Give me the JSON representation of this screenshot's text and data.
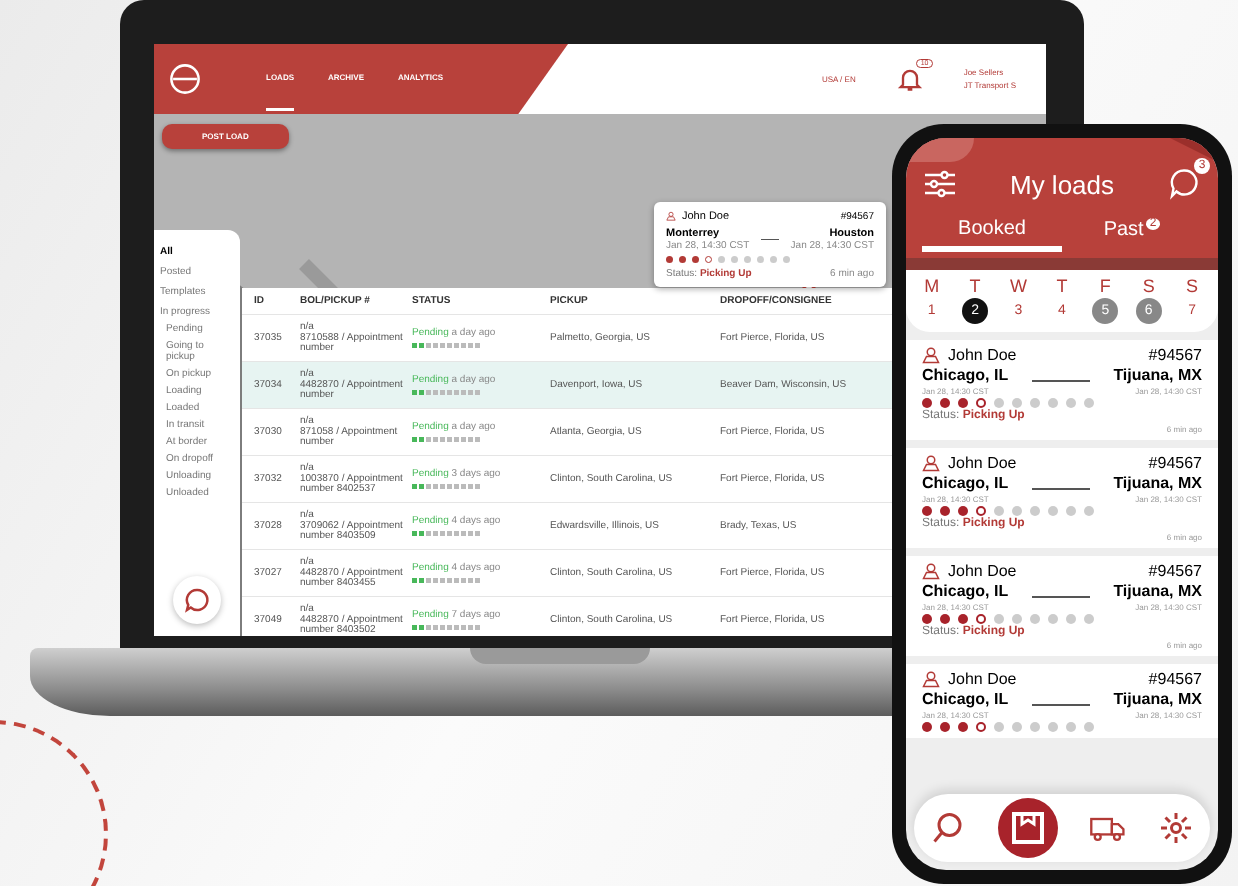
{
  "laptop": {
    "nav": [
      {
        "label": "LOADS",
        "selected": true
      },
      {
        "label": "ARCHIVE",
        "selected": false
      },
      {
        "label": "ANALYTICS",
        "selected": false
      }
    ],
    "region": "USA / EN",
    "notifications": "10",
    "user_name": "Joe Sellers",
    "user_company": "JT Transport S",
    "post_button": "POST LOAD",
    "sidebar": [
      {
        "label": "All",
        "kind": "header"
      },
      {
        "label": "Posted",
        "kind": "item"
      },
      {
        "label": "Templates",
        "kind": "item"
      },
      {
        "label": "In progress",
        "kind": "item"
      },
      {
        "label": "Pending",
        "kind": "sub"
      },
      {
        "label": "Going to pickup",
        "kind": "sub"
      },
      {
        "label": "On pickup",
        "kind": "sub"
      },
      {
        "label": "Loading",
        "kind": "sub"
      },
      {
        "label": "Loaded",
        "kind": "sub"
      },
      {
        "label": "In transit",
        "kind": "sub"
      },
      {
        "label": "At border",
        "kind": "sub"
      },
      {
        "label": "On dropoff",
        "kind": "sub"
      },
      {
        "label": "Unloading",
        "kind": "sub"
      },
      {
        "label": "Unloaded",
        "kind": "sub"
      }
    ],
    "popup": {
      "driver": "John Doe",
      "id": "#94567",
      "from": "Monterrey",
      "from_time": "Jan 28, 14:30 CST",
      "to": "Houston",
      "to_time": "Jan 28, 14:30 CST",
      "level": 0.3,
      "status_label": "Status:",
      "status": "Picking Up",
      "ago": "6 min ago"
    },
    "table": {
      "columns": [
        "ID",
        "BOL/PICKUP #",
        "STATUS",
        "PICKUP",
        "DROPOFF/CONSIGNEE"
      ],
      "rows": [
        {
          "id": "37035",
          "bol": "n/a",
          "bol_detail": "8710588 / Appointment number",
          "status": "Pending",
          "ago": "a day ago",
          "pickup": "Palmetto, Georgia, US",
          "dropoff": "Fort Pierce, Florida, US",
          "selected": false
        },
        {
          "id": "37034",
          "bol": "n/a",
          "bol_detail": "4482870 / Appointment number",
          "status": "Pending",
          "ago": "a day ago",
          "pickup": "Davenport, Iowa, US",
          "dropoff": "Beaver Dam, Wisconsin, US",
          "selected": true
        },
        {
          "id": "37030",
          "bol": "n/a",
          "bol_detail": "871058 / Appointment number",
          "status": "Pending",
          "ago": "a day ago",
          "pickup": "Atlanta, Georgia, US",
          "dropoff": "Fort Pierce, Florida, US",
          "selected": false
        },
        {
          "id": "37032",
          "bol": "n/a",
          "bol_detail": "1003870 / Appointment number 8402537",
          "status": "Pending",
          "ago": "3 days ago",
          "pickup": "Clinton, South Carolina, US",
          "dropoff": "Fort Pierce, Florida, US",
          "selected": false
        },
        {
          "id": "37028",
          "bol": "n/a",
          "bol_detail": "3709062 / Appointment number 8403509",
          "status": "Pending",
          "ago": "4 days ago",
          "pickup": "Edwardsville, Illinois, US",
          "dropoff": "Brady, Texas, US",
          "selected": false
        },
        {
          "id": "37027",
          "bol": "n/a",
          "bol_detail": "4482870 / Appointment number 8403455",
          "status": "Pending",
          "ago": "4 days ago",
          "pickup": "Clinton, South Carolina, US",
          "dropoff": "Fort Pierce, Florida, US",
          "selected": false
        },
        {
          "id": "37049",
          "bol": "n/a",
          "bol_detail": "4482870 / Appointment number 8403502",
          "status": "Pending",
          "ago": "7 days ago",
          "pickup": "Clinton, South Carolina, US",
          "dropoff": "Fort Pierce, Florida, US",
          "selected": false
        }
      ]
    }
  },
  "phone": {
    "title": "My loads",
    "chat_badge": "3",
    "tabs": [
      {
        "label": "Booked",
        "selected": true
      },
      {
        "label": "Past",
        "selected": false,
        "badge": "2"
      }
    ],
    "days": [
      {
        "letter": "M",
        "date": "1",
        "selected": false,
        "marked": false
      },
      {
        "letter": "T",
        "date": "2",
        "selected": true,
        "marked": false
      },
      {
        "letter": "W",
        "date": "3",
        "selected": false,
        "marked": false
      },
      {
        "letter": "T",
        "date": "4",
        "selected": false,
        "marked": false
      },
      {
        "letter": "F",
        "date": "5",
        "selected": false,
        "marked": true
      },
      {
        "letter": "S",
        "date": "6",
        "selected": false,
        "marked": true
      },
      {
        "letter": "S",
        "date": "7",
        "selected": false,
        "marked": false
      }
    ],
    "loads": [
      {
        "driver": "John Doe",
        "id": "#94567",
        "from": "Chicago, IL",
        "from_time": "Jan 28, 14:30 CST",
        "to": "Tijuana, MX",
        "to_time": "Jan 28, 14:30 CST",
        "level": 0.3,
        "status_label": "Status:",
        "status": "Picking Up",
        "ago": "6 min ago"
      },
      {
        "driver": "John Doe",
        "id": "#94567",
        "from": "Chicago, IL",
        "from_time": "Jan 28, 14:30 CST",
        "to": "Tijuana, MX",
        "to_time": "Jan 28, 14:30 CST",
        "level": 0.3,
        "status_label": "Status:",
        "status": "Picking Up",
        "ago": "6 min ago"
      },
      {
        "driver": "John Doe",
        "id": "#94567",
        "from": "Chicago, IL",
        "from_time": "Jan 28, 14:30 CST",
        "to": "Tijuana, MX",
        "to_time": "Jan 28, 14:30 CST",
        "level": 0.3,
        "status_label": "Status:",
        "status": "Picking Up",
        "ago": "6 min ago"
      },
      {
        "driver": "John Doe",
        "id": "#94567",
        "from": "Chicago, IL",
        "from_time": "Jan 28, 14:30 CST",
        "to": "Tijuana, MX",
        "to_time": "Jan 28, 14:30 CST",
        "level": 0.3
      }
    ]
  }
}
